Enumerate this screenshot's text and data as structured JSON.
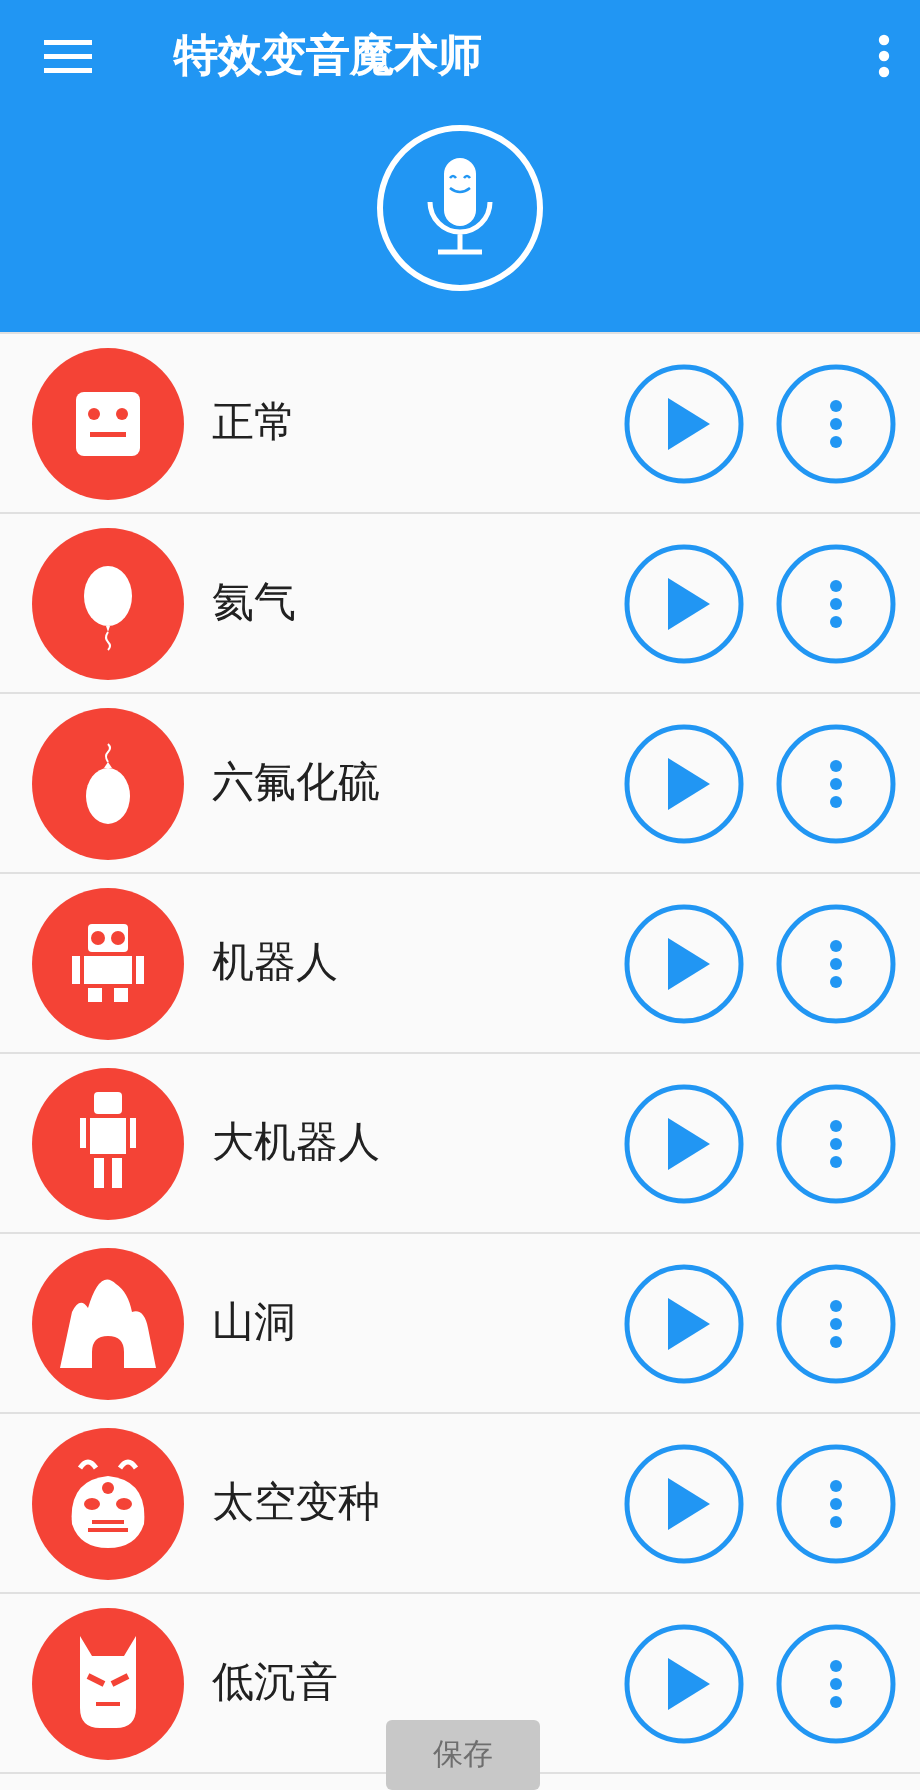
{
  "app_bar": {
    "title": "特效变音魔术师"
  },
  "effects": [
    {
      "name": "正常"
    },
    {
      "name": "氦气"
    },
    {
      "name": "六氟化硫"
    },
    {
      "name": "机器人"
    },
    {
      "name": "大机器人"
    },
    {
      "name": "山洞"
    },
    {
      "name": "太空变种"
    },
    {
      "name": "低沉音"
    }
  ],
  "save_button": {
    "label": "保存",
    "disabled": true
  }
}
